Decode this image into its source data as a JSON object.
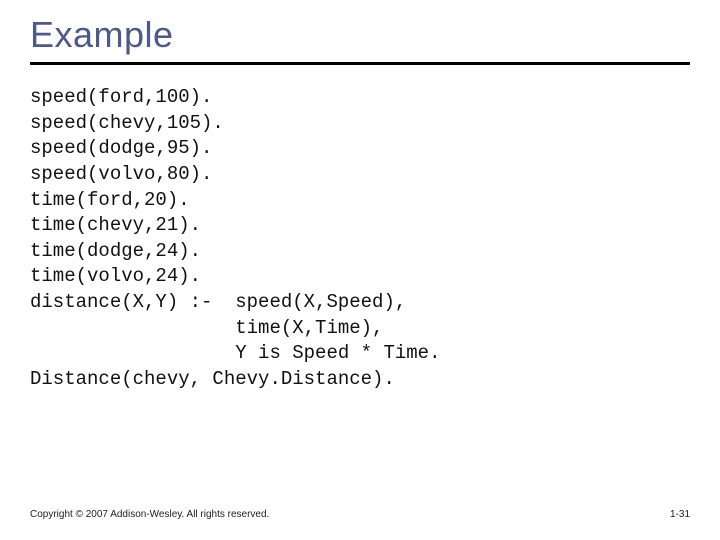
{
  "title": "Example",
  "code_lines": [
    "speed(ford,100).",
    "speed(chevy,105).",
    "speed(dodge,95).",
    "speed(volvo,80).",
    "time(ford,20).",
    "time(chevy,21).",
    "time(dodge,24).",
    "time(volvo,24).",
    "distance(X,Y) :-  speed(X,Speed),",
    "                  time(X,Time),",
    "                  Y is Speed * Time.",
    "Distance(chevy, Chevy.Distance)."
  ],
  "footer": {
    "copyright": "Copyright © 2007 Addison-Wesley. All rights reserved.",
    "page": "1-31"
  }
}
